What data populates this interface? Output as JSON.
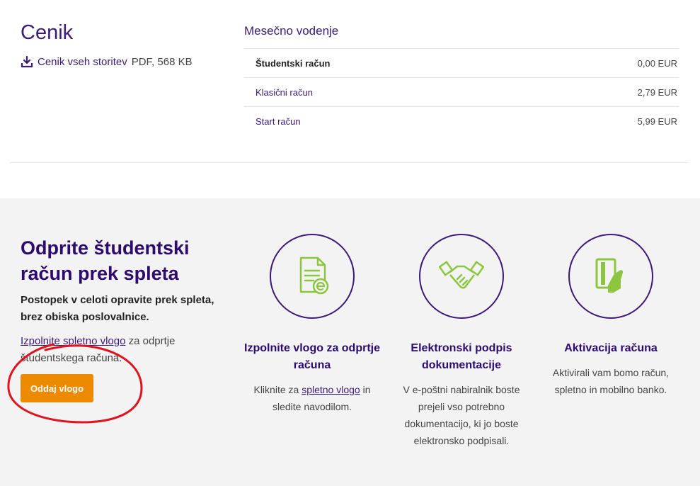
{
  "pricing": {
    "title": "Cenik",
    "pdf_link_label": "Cenik vseh storitev",
    "pdf_meta": "PDF, 568 KB",
    "monthly_title": "Mesečno vodenje",
    "rows": [
      {
        "name": "Študentski račun",
        "value": "0,00 EUR"
      },
      {
        "name": "Klasični račun",
        "value": "2,79 EUR"
      },
      {
        "name": "Start račun",
        "value": "5,99 EUR"
      }
    ]
  },
  "promo": {
    "title": "Odprite študentski račun prek spleta",
    "subtitle": "Postopek v celoti opravite prek spleta, brez obiska poslovalnice.",
    "text_link": "Izpolnite spletno vlogo",
    "text_rest": " za odprtje študentskega računa.",
    "button_label": "Oddaj vlogo"
  },
  "steps": [
    {
      "icon": "document-form-icon",
      "title": "Izpolnite vlogo za odprtje računa",
      "text_before": "Kliknite za ",
      "text_link": "spletno vlogo",
      "text_after": " in sledite navodilom."
    },
    {
      "icon": "handshake-icon",
      "title": "Elektronski podpis dokumentacije",
      "text_before": "V e-poštni nabiralnik boste prejeli vso potrebno dokumentacijo, ki jo boste elektronsko podpisali.",
      "text_link": "",
      "text_after": ""
    },
    {
      "icon": "card-in-hand-icon",
      "title": "Aktivacija računa",
      "text_before": "Aktivirali vam bomo račun, spletno in mobilno banko.",
      "text_link": "",
      "text_after": ""
    }
  ],
  "colors": {
    "brand_purple": "#3b1a7a",
    "accent_orange": "#ee8a00",
    "icon_green": "#8cc63f",
    "annotation_red": "#e0141e"
  }
}
